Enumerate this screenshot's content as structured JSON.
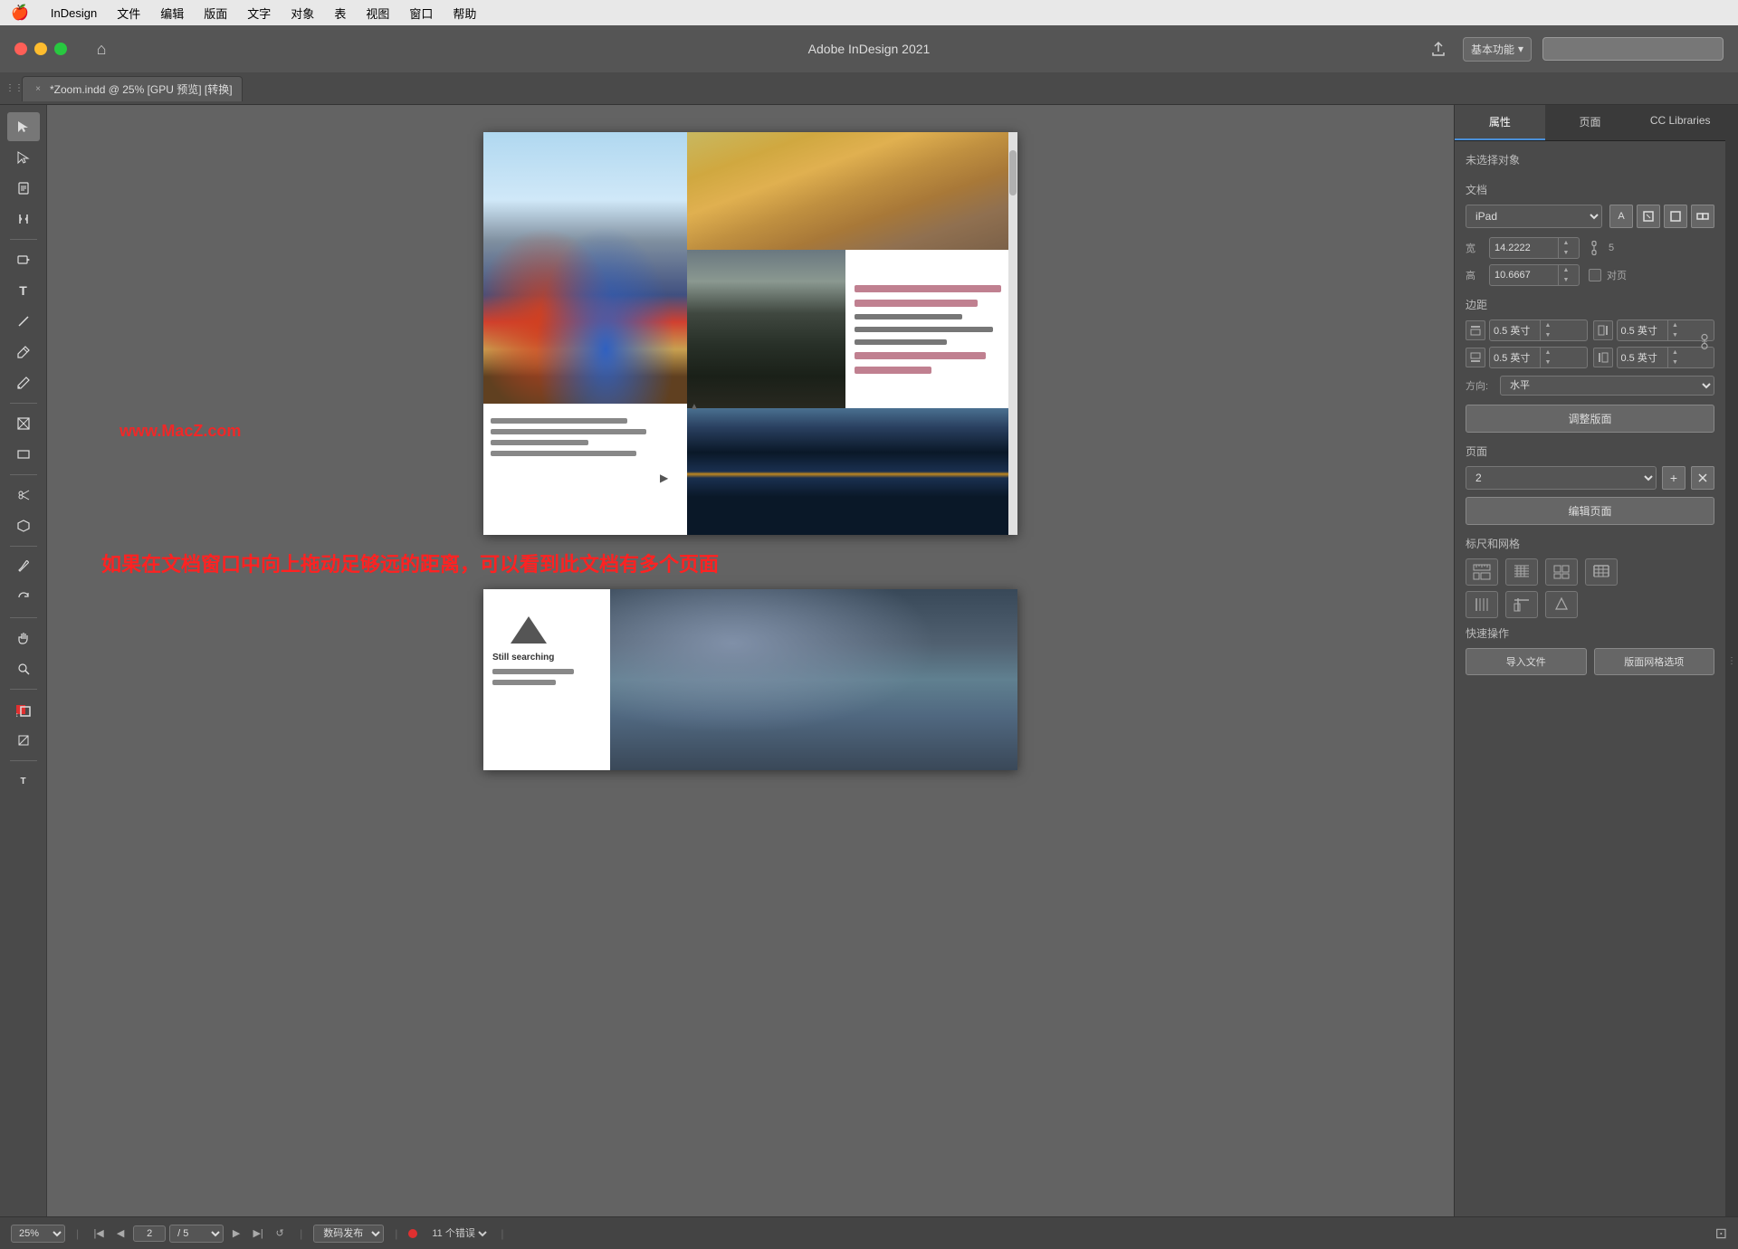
{
  "menubar": {
    "apple": "🍎",
    "items": [
      "InDesign",
      "文件",
      "编辑",
      "版面",
      "文字",
      "对象",
      "表",
      "视图",
      "窗口",
      "帮助"
    ]
  },
  "titlebar": {
    "title": "Adobe InDesign 2021",
    "workspace": "基本功能",
    "workspace_arrow": "▾"
  },
  "tab": {
    "close": "×",
    "filename": "*Zoom.indd @ 25% [GPU 预览] [转换]"
  },
  "canvas": {
    "watermark": "www.MacZ.com",
    "annotation": "如果在文档窗口中向上拖动足够远的距离，可以看到此文档有多个页面",
    "page2_title": "Still searching",
    "page2_text_line1_pos": "left: 10px; top: 88px; width: 90px;",
    "page2_text_line2_pos": "left: 10px; top: 100px; width: 70px;"
  },
  "right_panel": {
    "tabs": [
      "属性",
      "页面",
      "CC Libraries"
    ],
    "active_tab": "属性",
    "no_selection": "未选择对象",
    "doc_section": "文档",
    "preset": "iPad",
    "width_label": "宽",
    "width_value": "14.2222",
    "height_label": "高",
    "height_value": "10.6667",
    "facing_pages_label": "对页",
    "margin_section": "边距",
    "margin_top": "0.5 英寸",
    "margin_bottom": "0.5 英寸",
    "margin_left": "0.5 英寸",
    "margin_right": "0.5 英寸",
    "direction_label": "方向:",
    "direction_value": "水平",
    "adjust_btn": "调整版面",
    "pages_section": "页面",
    "page_number": "2",
    "edit_page_btn": "编辑页面",
    "rulers_section": "标尺和网格",
    "quick_actions_section": "快速操作",
    "import_btn": "导入文件",
    "frame_grid_btn": "版面网格选项"
  },
  "statusbar": {
    "zoom": "25%",
    "page": "2",
    "publish": "数码发布",
    "errors": "11 个错误"
  },
  "icons": {
    "selection": "↖",
    "direct_select": "↖",
    "page": "📄",
    "pen": "✒",
    "pencil": "✏",
    "rectangle": "▭",
    "scissor": "✂",
    "transform": "⬡",
    "zoom": "🔍",
    "hand": "✋",
    "fill": "■",
    "type": "T",
    "line": "/",
    "frame": "⊞",
    "gradient": "▦",
    "note": "📝",
    "rotate": "↻",
    "shear": "◇",
    "eyedrop": "🖌"
  }
}
